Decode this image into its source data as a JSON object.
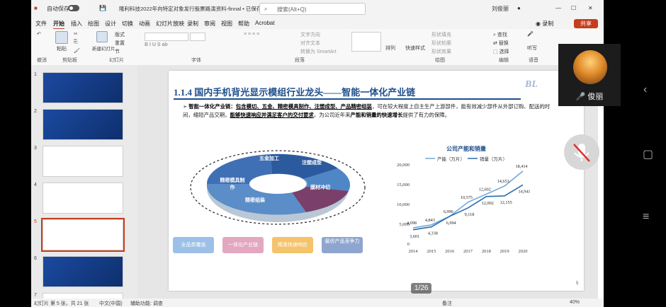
{
  "titlebar": {
    "autosave": "自动保存",
    "doc_title": "隆利科技2022年向特定对象发行股票路演资料-finnal • 已保存到这台电脑",
    "search_placeholder": "搜索(Alt+Q)",
    "user": "刘俊丽"
  },
  "menu": [
    "文件",
    "开始",
    "插入",
    "绘图",
    "设计",
    "切换",
    "动画",
    "幻灯片放映",
    "录制",
    "审阅",
    "视图",
    "帮助",
    "Acrobat"
  ],
  "menu_active": "开始",
  "ribbon": {
    "groups": [
      "撤消",
      "剪贴板",
      "幻灯片",
      "字体",
      "段落",
      "绘图",
      "编辑",
      "语音"
    ],
    "paste": "粘贴",
    "new_slide": "新建幻灯片",
    "layout": "版式",
    "reset": "重置",
    "section": "节",
    "text_direction": "文字方向",
    "align_text": "对齐文本",
    "smartart": "转换为 SmartArt",
    "arrange": "排列",
    "quick_styles": "快速样式",
    "shape_fill": "形状填充",
    "shape_outline": "形状轮廓",
    "shape_effects": "形状效果",
    "find": "查找",
    "replace": "替换",
    "select": "选择",
    "dictate": "听写",
    "record": "录制",
    "share": "共享"
  },
  "slides": {
    "numbers": [
      "1",
      "2",
      "3",
      "4",
      "5",
      "6",
      "7"
    ],
    "selected": "5"
  },
  "slide": {
    "title": "1.1.4 国内手机背光显示模组行业龙头——智能一体化产业链",
    "bullet_lead": "智能一体化产业链：",
    "bullet_bold1": "包含模切、五金、精密模具制作、注塑成型、产品精密组装",
    "bullet_rest1": "，可在较大程度上自主生产上游部件，能有效减少部件从外部订购、配送的时间，缩短产品交期，",
    "bullet_bold2": "能够快速响应并满足客户的交付要求",
    "bullet_rest2": "，为公司近年来",
    "bullet_bold3": "产能和销量的快速增长",
    "bullet_rest3": "提供了有力的保障。",
    "ring_labels": [
      "五金加工",
      "注塑成型",
      "精密模具制作",
      "膜材冲切",
      "精密组装"
    ],
    "pills": [
      "全品类覆盖",
      "一体化产业链",
      "精准快速响应",
      "最优产品竞争力"
    ],
    "page_num": "5",
    "logo": "BL"
  },
  "chart_data": {
    "type": "line",
    "title": "公司产能和销量",
    "x": [
      "2014",
      "2015",
      "2016",
      "2017",
      "2018",
      "2019",
      "2020"
    ],
    "series": [
      {
        "name": "产能（万片）",
        "values": [
          4098,
          4843,
          6990,
          10575,
          12602,
          14653,
          18414
        ]
      },
      {
        "name": "销量（万片）",
        "values": [
          3601,
          4338,
          6994,
          9118,
          12002,
          12155,
          14941
        ]
      }
    ],
    "yticks": [
      "0",
      "5,000",
      "10,000",
      "15,000",
      "20,000"
    ],
    "ylim": [
      0,
      20000
    ],
    "data_labels": {
      "capacity": [
        "4,098",
        "4,843",
        "6,990",
        "10,575",
        "12,602",
        "14,653",
        "18,414"
      ],
      "sales": [
        "3,601",
        "4,338",
        "6,994",
        "9,118",
        "12,002",
        "12,155",
        "14,941"
      ]
    },
    "colors": {
      "capacity": "#6fa8d6",
      "sales": "#2b6cb0"
    }
  },
  "status": {
    "slide_info": "幻灯片 第 5 张，共 21 张",
    "language": "中文(中国)",
    "accessibility": "辅助功能: 调查",
    "notes": "备注",
    "zoom": "40%"
  },
  "pager": "1/26",
  "meeting": {
    "participant": "俊丽"
  }
}
